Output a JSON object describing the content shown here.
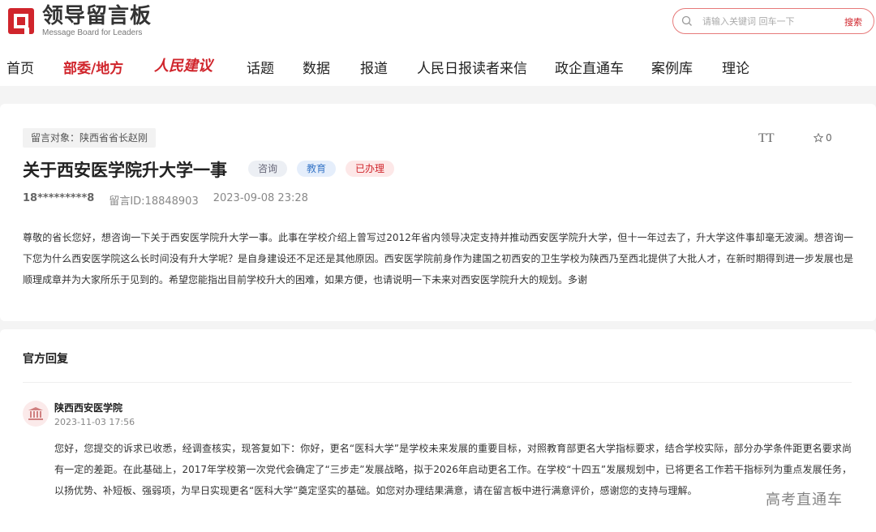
{
  "header": {
    "logo_title": "领导留言板",
    "logo_subtitle": "Message Board for Leaders",
    "search_placeholder": "请输入关键词 回车一下",
    "search_button": "搜索"
  },
  "nav": {
    "items": [
      "首页",
      "部委/地方",
      "人民建议",
      "话题",
      "数据",
      "报道",
      "人民日报读者来信",
      "政企直通车",
      "案例库",
      "理论"
    ]
  },
  "question": {
    "target": "留言对象：陕西省省长赵刚",
    "title": "关于西安医学院升大学一事",
    "tags": [
      "咨询",
      "教育",
      "已办理"
    ],
    "user": "18*********8",
    "message_id": "留言ID:18848903",
    "datetime": "2023-09-08 23:28",
    "font_tool": "TT",
    "favorites": "0",
    "body": "尊敬的省长您好，想咨询一下关于西安医学院升大学一事。此事在学校介绍上曾写过2012年省内领导决定支持并推动西安医学院升大学，但十一年过去了，升大学这件事却毫无波澜。想咨询一下您为什么西安医学院这么长时间没有升大学呢？是自身建设还不足还是其他原因。西安医学院前身作为建国之初西安的卫生学校为陕西乃至西北提供了大批人才，在新时期得到进一步发展也是顺理成章并为大家所乐于见到的。希望您能指出目前学校升大的困难，如果方便，也请说明一下未来对西安医学院升大的规划。多谢"
  },
  "reply": {
    "heading": "官方回复",
    "org": "陕西西安医学院",
    "datetime": "2023-11-03 17:56",
    "body": "您好，您提交的诉求已收悉，经调查核实，现答复如下：你好，更名“医科大学”是学校未来发展的重要目标，对照教育部更名大学指标要求，结合学校实际，部分办学条件距更名要求尚有一定的差距。在此基础上，2017年学校第一次党代会确定了“三步走”发展战略，拟于2026年启动更名工作。在学校“十四五”发展规划中，已将更名工作若干指标列为重点发展任务，以扬优势、补短板、强弱项，为早日实现更名“医科大学”奠定坚实的基础。如您对办理结果满意，请在留言板中进行满意评价，感谢您的支持与理解。"
  },
  "watermark": "高考直通车",
  "colors": {
    "accent": "#d0252c"
  }
}
